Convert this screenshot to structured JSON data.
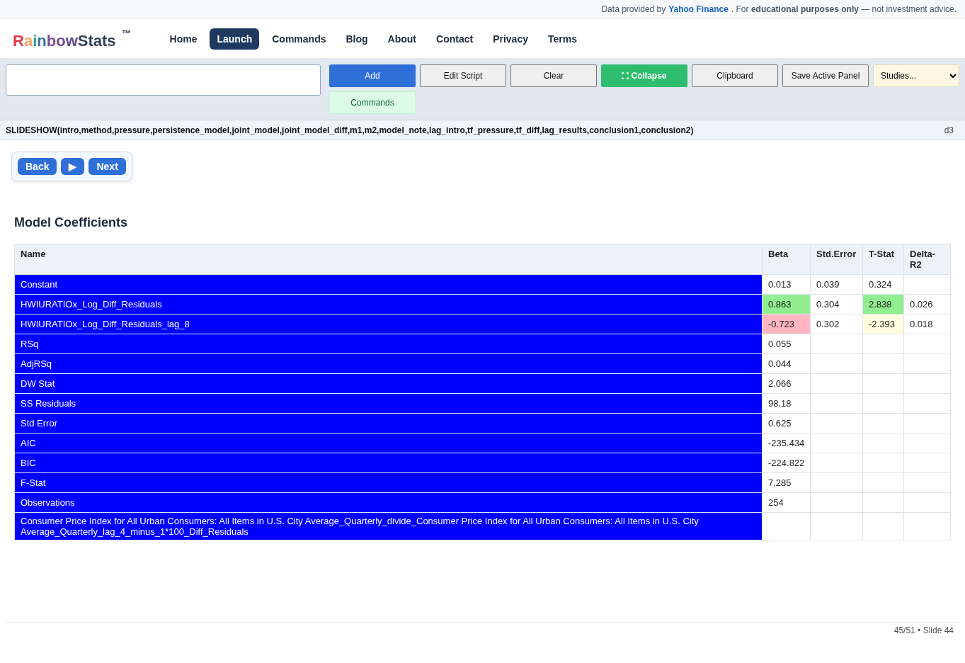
{
  "notice": {
    "prefix": "Data provided by",
    "link": "Yahoo Finance",
    "middle": ". For",
    "emphasis": "educational purposes only",
    "suffix": "— not investment advice."
  },
  "brand": {
    "colored": "Rainbow",
    "rest": "Stats",
    "mark": "™"
  },
  "nav": [
    {
      "label": "Home",
      "selected": false
    },
    {
      "label": "Launch",
      "selected": true
    },
    {
      "label": "Commands",
      "selected": false
    },
    {
      "label": "Blog",
      "selected": false
    },
    {
      "label": "About",
      "selected": false
    },
    {
      "label": "Contact",
      "selected": false
    },
    {
      "label": "Privacy",
      "selected": false
    },
    {
      "label": "Terms",
      "selected": false
    }
  ],
  "toolbar": {
    "buttons": [
      {
        "label": "Add",
        "kind": "primary"
      },
      {
        "label": "Edit Script",
        "kind": "plain"
      },
      {
        "label": "Clear",
        "kind": "plain"
      },
      {
        "label": "Collapse",
        "kind": "success"
      },
      {
        "label": "Clipboard",
        "kind": "plain"
      },
      {
        "label": "Save Active Panel",
        "kind": "plain"
      }
    ],
    "select": "Studies...",
    "secondary": "Commands"
  },
  "command": {
    "text": "SLIDESHOW(intro,method,pressure,persistence_model,joint_model,joint_model_diff,m1,m2,model_note,lag_intro,tf_pressure,tf_diff,lag_results,conclusion1,conclusion2)",
    "tag": "d3"
  },
  "slide_nav": {
    "back": "Back",
    "play": "▶",
    "next": "Next"
  },
  "title": "Model Coefficients",
  "table": {
    "columns": [
      "Name",
      "Beta",
      "Std.Error",
      "T-Stat",
      "Delta-R2"
    ],
    "rows": [
      {
        "cells": [
          {
            "text": "Constant"
          },
          {
            "text": "0.013"
          },
          {
            "text": "0.039"
          },
          {
            "text": "0.324"
          }
        ]
      },
      {
        "cells": [
          {
            "text": "HWIURATIOx_Log_Diff_Residuals"
          },
          {
            "text": "0.863",
            "color": "#90ee90"
          },
          {
            "text": "0.304"
          },
          {
            "text": "2.838",
            "color": "#90ee90"
          },
          {
            "text": "0.026"
          }
        ]
      },
      {
        "cells": [
          {
            "text": "HWIURATIOx_Log_Diff_Residuals_lag_8"
          },
          {
            "text": "-0.723",
            "color": "#ffb6c1"
          },
          {
            "text": "0.302"
          },
          {
            "text": "-2.393",
            "color": "#ffffe0"
          },
          {
            "text": "0.018"
          }
        ]
      },
      {
        "cells": [
          {
            "text": "RSq"
          },
          {
            "text": "0.055"
          }
        ]
      },
      {
        "cells": [
          {
            "text": "AdjRSq"
          },
          {
            "text": "0.044"
          }
        ]
      },
      {
        "cells": [
          {
            "text": "DW Stat"
          },
          {
            "text": "2.066"
          }
        ]
      },
      {
        "cells": [
          {
            "text": "SS Residuals"
          },
          {
            "text": "98.18"
          }
        ]
      },
      {
        "cells": [
          {
            "text": "Std Error"
          },
          {
            "text": "0.625"
          }
        ]
      },
      {
        "cells": [
          {
            "text": "AIC"
          },
          {
            "text": "-235.434"
          }
        ]
      },
      {
        "cells": [
          {
            "text": "BIC"
          },
          {
            "text": "-224.822"
          }
        ]
      },
      {
        "cells": [
          {
            "text": "F-Stat"
          },
          {
            "text": "7.285"
          }
        ]
      },
      {
        "cells": [
          {
            "text": "Observations"
          },
          {
            "text": "254"
          }
        ]
      },
      {
        "cells": [
          {
            "text": "Consumer Price Index for All Urban Consumers: All Items in U.S. City Average_Quarterly_divide_Consumer Price Index for All Urban Consumers: All Items in U.S. City Average_Quarterly_lag_4_minus_1*100_Diff_Residuals"
          }
        ]
      }
    ]
  },
  "footer": "45/51 • Slide 44"
}
